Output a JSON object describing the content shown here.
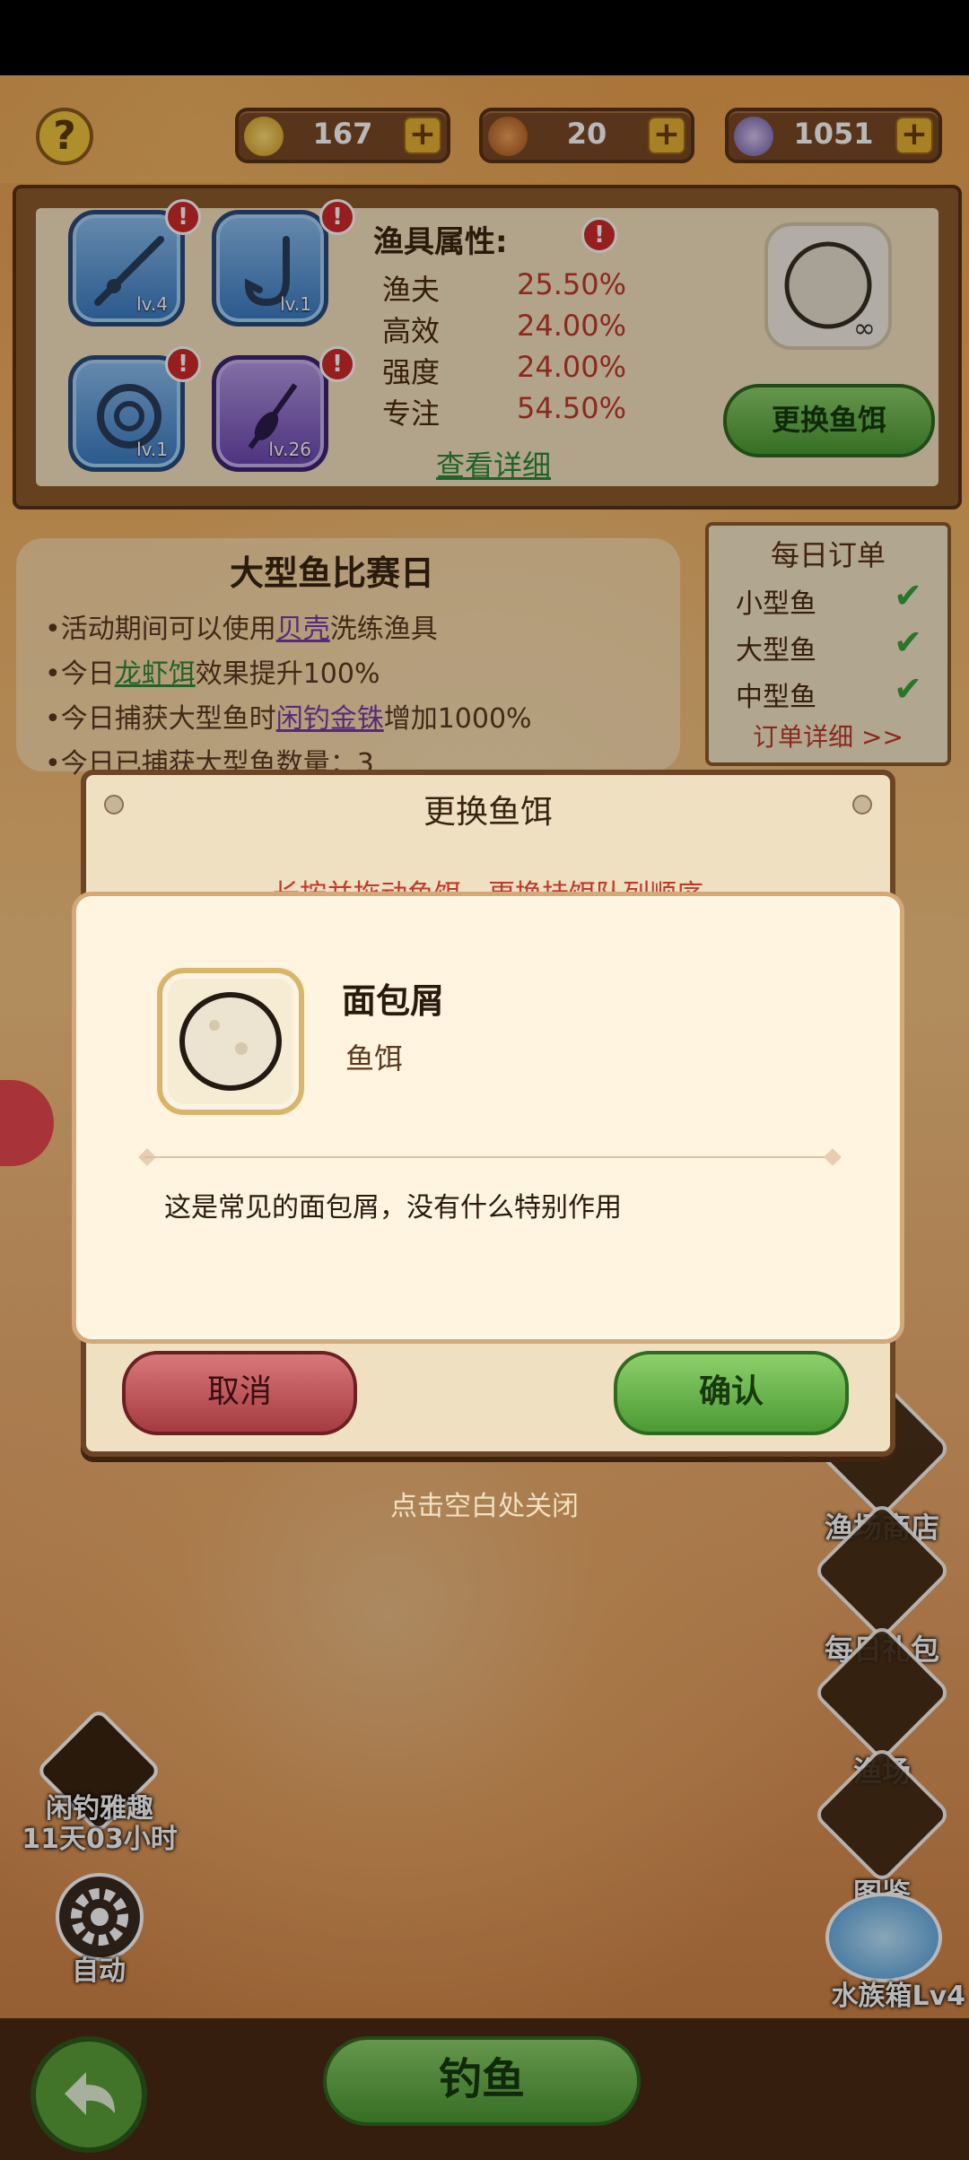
{
  "currencies": [
    {
      "value": "167",
      "icon": "coin-icon"
    },
    {
      "value": "20",
      "icon": "drumstick-icon"
    },
    {
      "value": "1051",
      "icon": "pearl-shell-icon"
    }
  ],
  "help": {
    "label": "?"
  },
  "gear": {
    "slots": [
      {
        "level": "lv.4",
        "icon": "fishing-rod-icon"
      },
      {
        "level": "lv.1",
        "icon": "fish-hook-icon"
      },
      {
        "level": "lv.1",
        "icon": "fishing-reel-icon"
      },
      {
        "level": "lv.26",
        "icon": "float-icon"
      }
    ],
    "attributes_title": "渔具属性:",
    "attributes": [
      {
        "name": "渔夫",
        "value": "25.50%"
      },
      {
        "name": "高效",
        "value": "24.00%"
      },
      {
        "name": "强度",
        "value": "24.00%"
      },
      {
        "name": "专注",
        "value": "54.50%"
      }
    ],
    "view_details": "查看详细",
    "bait_count": "∞",
    "change_bait": "更换鱼饵"
  },
  "event": {
    "title": "大型鱼比赛日",
    "lines": [
      {
        "prefix": "•活动期间可以使用",
        "highlight": "贝壳",
        "suffix": "洗练渔具"
      },
      {
        "prefix": "•今日",
        "highlight": "龙虾饵",
        "suffix": "效果提升100%"
      },
      {
        "prefix": "•今日捕获大型鱼时",
        "highlight": "闲钓金铢",
        "suffix": "增加1000%"
      },
      {
        "prefix": "•今日已捕获大型鱼数量：3",
        "highlight": "",
        "suffix": ""
      }
    ]
  },
  "daily_orders": {
    "title": "每日订单",
    "items": [
      {
        "name": "小型鱼",
        "done": "✔"
      },
      {
        "name": "大型鱼",
        "done": "✔"
      },
      {
        "name": "中型鱼",
        "done": "✔"
      }
    ],
    "details": "订单详细 >>"
  },
  "bait_dialog": {
    "title": "更换鱼饵",
    "hint": "长按并拖动鱼饵，更换挂饵队列顺序",
    "cancel": "取消",
    "confirm": "确认",
    "close_hint": "点击空白处关闭"
  },
  "info_card": {
    "name": "面包屑",
    "type": "鱼饵",
    "description": "这是常见的面包屑，没有什么特别作用"
  },
  "side_buttons": [
    {
      "label": "渔场商店",
      "icon": "shop-icon"
    },
    {
      "label": "每日礼包",
      "icon": "gift-box-icon"
    },
    {
      "label": "渔场",
      "icon": "fishing-ground-icon"
    },
    {
      "label": "图鉴",
      "icon": "encyclopedia-icon"
    }
  ],
  "aquarium": {
    "label": "水族箱Lv4"
  },
  "leisure": {
    "title": "闲钓雅趣",
    "timer": "11天03小时"
  },
  "auto": {
    "label": "自动"
  },
  "fish_button": {
    "label": "钓鱼"
  }
}
